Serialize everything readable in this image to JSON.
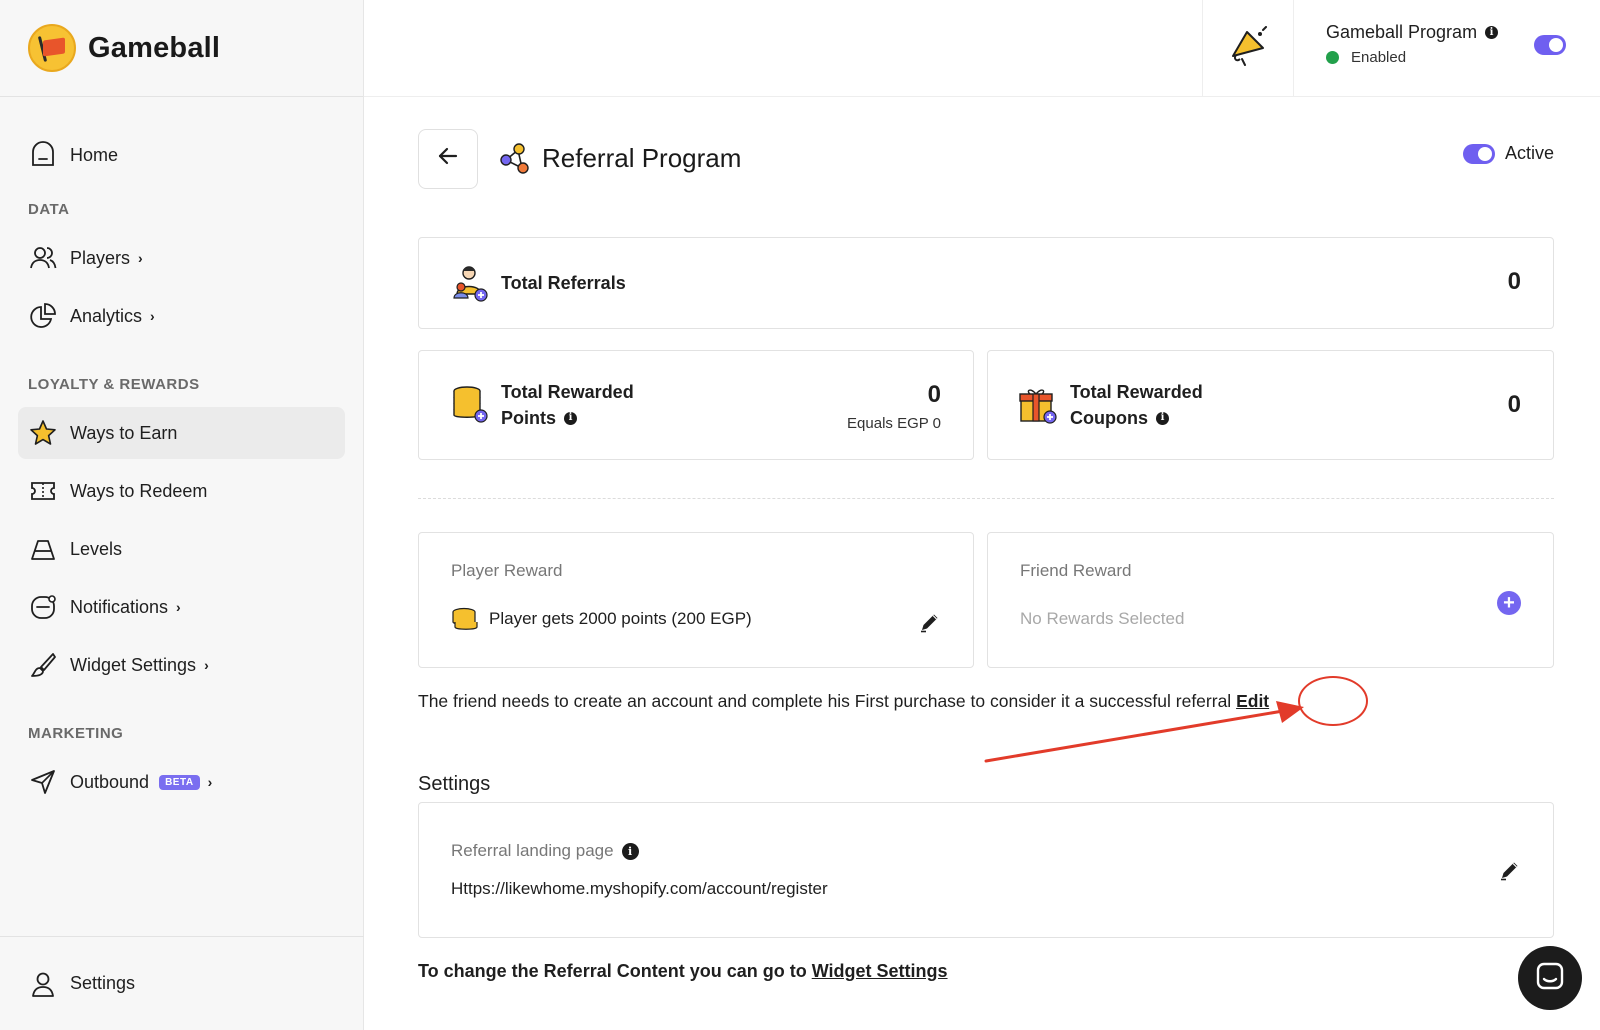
{
  "brand": {
    "name": "Gameball"
  },
  "sidebar": {
    "home": "Home",
    "section_data": "DATA",
    "players": "Players",
    "analytics": "Analytics",
    "section_loyalty": "LOYALTY & REWARDS",
    "ways_to_earn": "Ways to Earn",
    "ways_to_redeem": "Ways to Redeem",
    "levels": "Levels",
    "notifications": "Notifications",
    "widget_settings": "Widget Settings",
    "section_marketing": "MARKETING",
    "outbound": "Outbound",
    "outbound_badge": "BETA",
    "settings": "Settings",
    "chevron": "›"
  },
  "header": {
    "program_title": "Gameball Program",
    "program_status": "Enabled",
    "info_glyph": "i"
  },
  "page": {
    "title": "Referral Program",
    "active_label": "Active",
    "total_referrals_label": "Total Referrals",
    "total_referrals_value": "0",
    "total_points_label_1": "Total Rewarded",
    "total_points_label_2": "Points",
    "total_points_value": "0",
    "total_points_equals": "Equals EGP 0",
    "total_coupons_label_1": "Total Rewarded",
    "total_coupons_label_2": "Coupons",
    "total_coupons_value": "0",
    "player_reward_label": "Player Reward",
    "player_reward_text": "Player gets 2000 points (200 EGP)",
    "friend_reward_label": "Friend Reward",
    "friend_reward_text": "No Rewards Selected",
    "referral_note": "The friend needs to create an account and complete his First purchase to consider it a successful referral",
    "edit_link": "Edit",
    "settings_title": "Settings",
    "landing_label": "Referral landing page",
    "landing_url": "Https://likewhome.myshopify.com/account/register",
    "footer_prefix": "To change the Referral Content you can go to ",
    "footer_link": "Widget Settings",
    "plus_glyph": "+"
  },
  "colors": {
    "accent": "#6f5ff0",
    "status_green": "#22a04b",
    "annotation_red": "#e23b2a"
  }
}
